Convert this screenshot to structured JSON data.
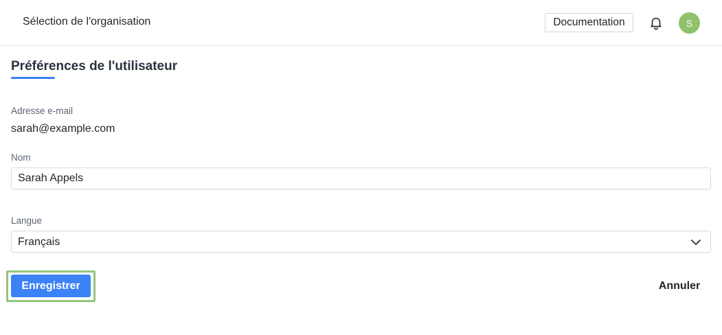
{
  "header": {
    "org_selector": "Sélection de l'organisation",
    "documentation_label": "Documentation",
    "notification_icon": "bell-icon",
    "avatar_initial": "S",
    "avatar_color": "#8fc26a"
  },
  "page": {
    "title": "Préférences de l'utilisateur",
    "accent_color": "#3b82f6"
  },
  "form": {
    "email_label": "Adresse e-mail",
    "email_value": "sarah@example.com",
    "name_label": "Nom",
    "name_value": "Sarah Appels",
    "language_label": "Langue",
    "language_value": "Français",
    "language_icon": "chevron-down-icon"
  },
  "actions": {
    "save_label": "Enregistrer",
    "cancel_label": "Annuler"
  }
}
